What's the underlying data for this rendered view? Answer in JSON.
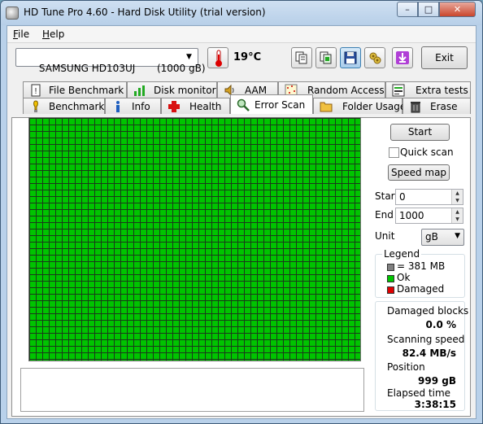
{
  "window": {
    "title": "HD Tune Pro 4.60 - Hard Disk Utility (trial version)",
    "controls": {
      "minimize": "–",
      "maximize": "□",
      "close": "✕"
    }
  },
  "menu": {
    "file": "File",
    "help": "Help"
  },
  "toolbar": {
    "drive": "SAMSUNG HD103UJ       (1000 gB)",
    "temperature": "19°C",
    "icons": [
      "copy-text-icon",
      "copy-screenshot-icon",
      "save-icon",
      "options-icon",
      "download-icon"
    ],
    "exit_label": "Exit"
  },
  "tabs_top": [
    {
      "label": "File Benchmark",
      "icon": "file-benchmark-icon"
    },
    {
      "label": "Disk monitor",
      "icon": "disk-monitor-icon"
    },
    {
      "label": "AAM",
      "icon": "speaker-icon"
    },
    {
      "label": "Random Access",
      "icon": "random-access-icon"
    },
    {
      "label": "Extra tests",
      "icon": "extra-tests-icon"
    }
  ],
  "tabs_bottom": [
    {
      "label": "Benchmark",
      "icon": "benchmark-icon"
    },
    {
      "label": "Info",
      "icon": "info-icon"
    },
    {
      "label": "Health",
      "icon": "health-icon"
    },
    {
      "label": "Error Scan",
      "icon": "magnifier-icon",
      "selected": true
    },
    {
      "label": "Folder Usage",
      "icon": "folder-icon"
    },
    {
      "label": "Erase",
      "icon": "trash-icon"
    }
  ],
  "scan": {
    "start_button": "Start",
    "quick_scan_label": "Quick scan",
    "quick_scan_checked": false,
    "speed_map_button": "Speed map",
    "start_label": "Start",
    "start_value": "0",
    "end_label": "End",
    "end_value": "1000",
    "unit_label": "Unit",
    "unit_value": "gB",
    "block_status": "all ok",
    "colors": {
      "ok": "#00c400",
      "damaged": "#e00000",
      "block_size_swatch": "#808080"
    }
  },
  "legend": {
    "title": "Legend",
    "block_size": "= 381 MB",
    "ok": "Ok",
    "damaged": "Damaged"
  },
  "stats": {
    "damaged_blocks_label": "Damaged blocks",
    "damaged_blocks_value": "0.0 %",
    "scanning_speed_label": "Scanning speed",
    "scanning_speed_value": "82.4 MB/s",
    "position_label": "Position",
    "position_value": "999 gB",
    "elapsed_time_label": "Elapsed time",
    "elapsed_time_value": "3:38:15"
  }
}
